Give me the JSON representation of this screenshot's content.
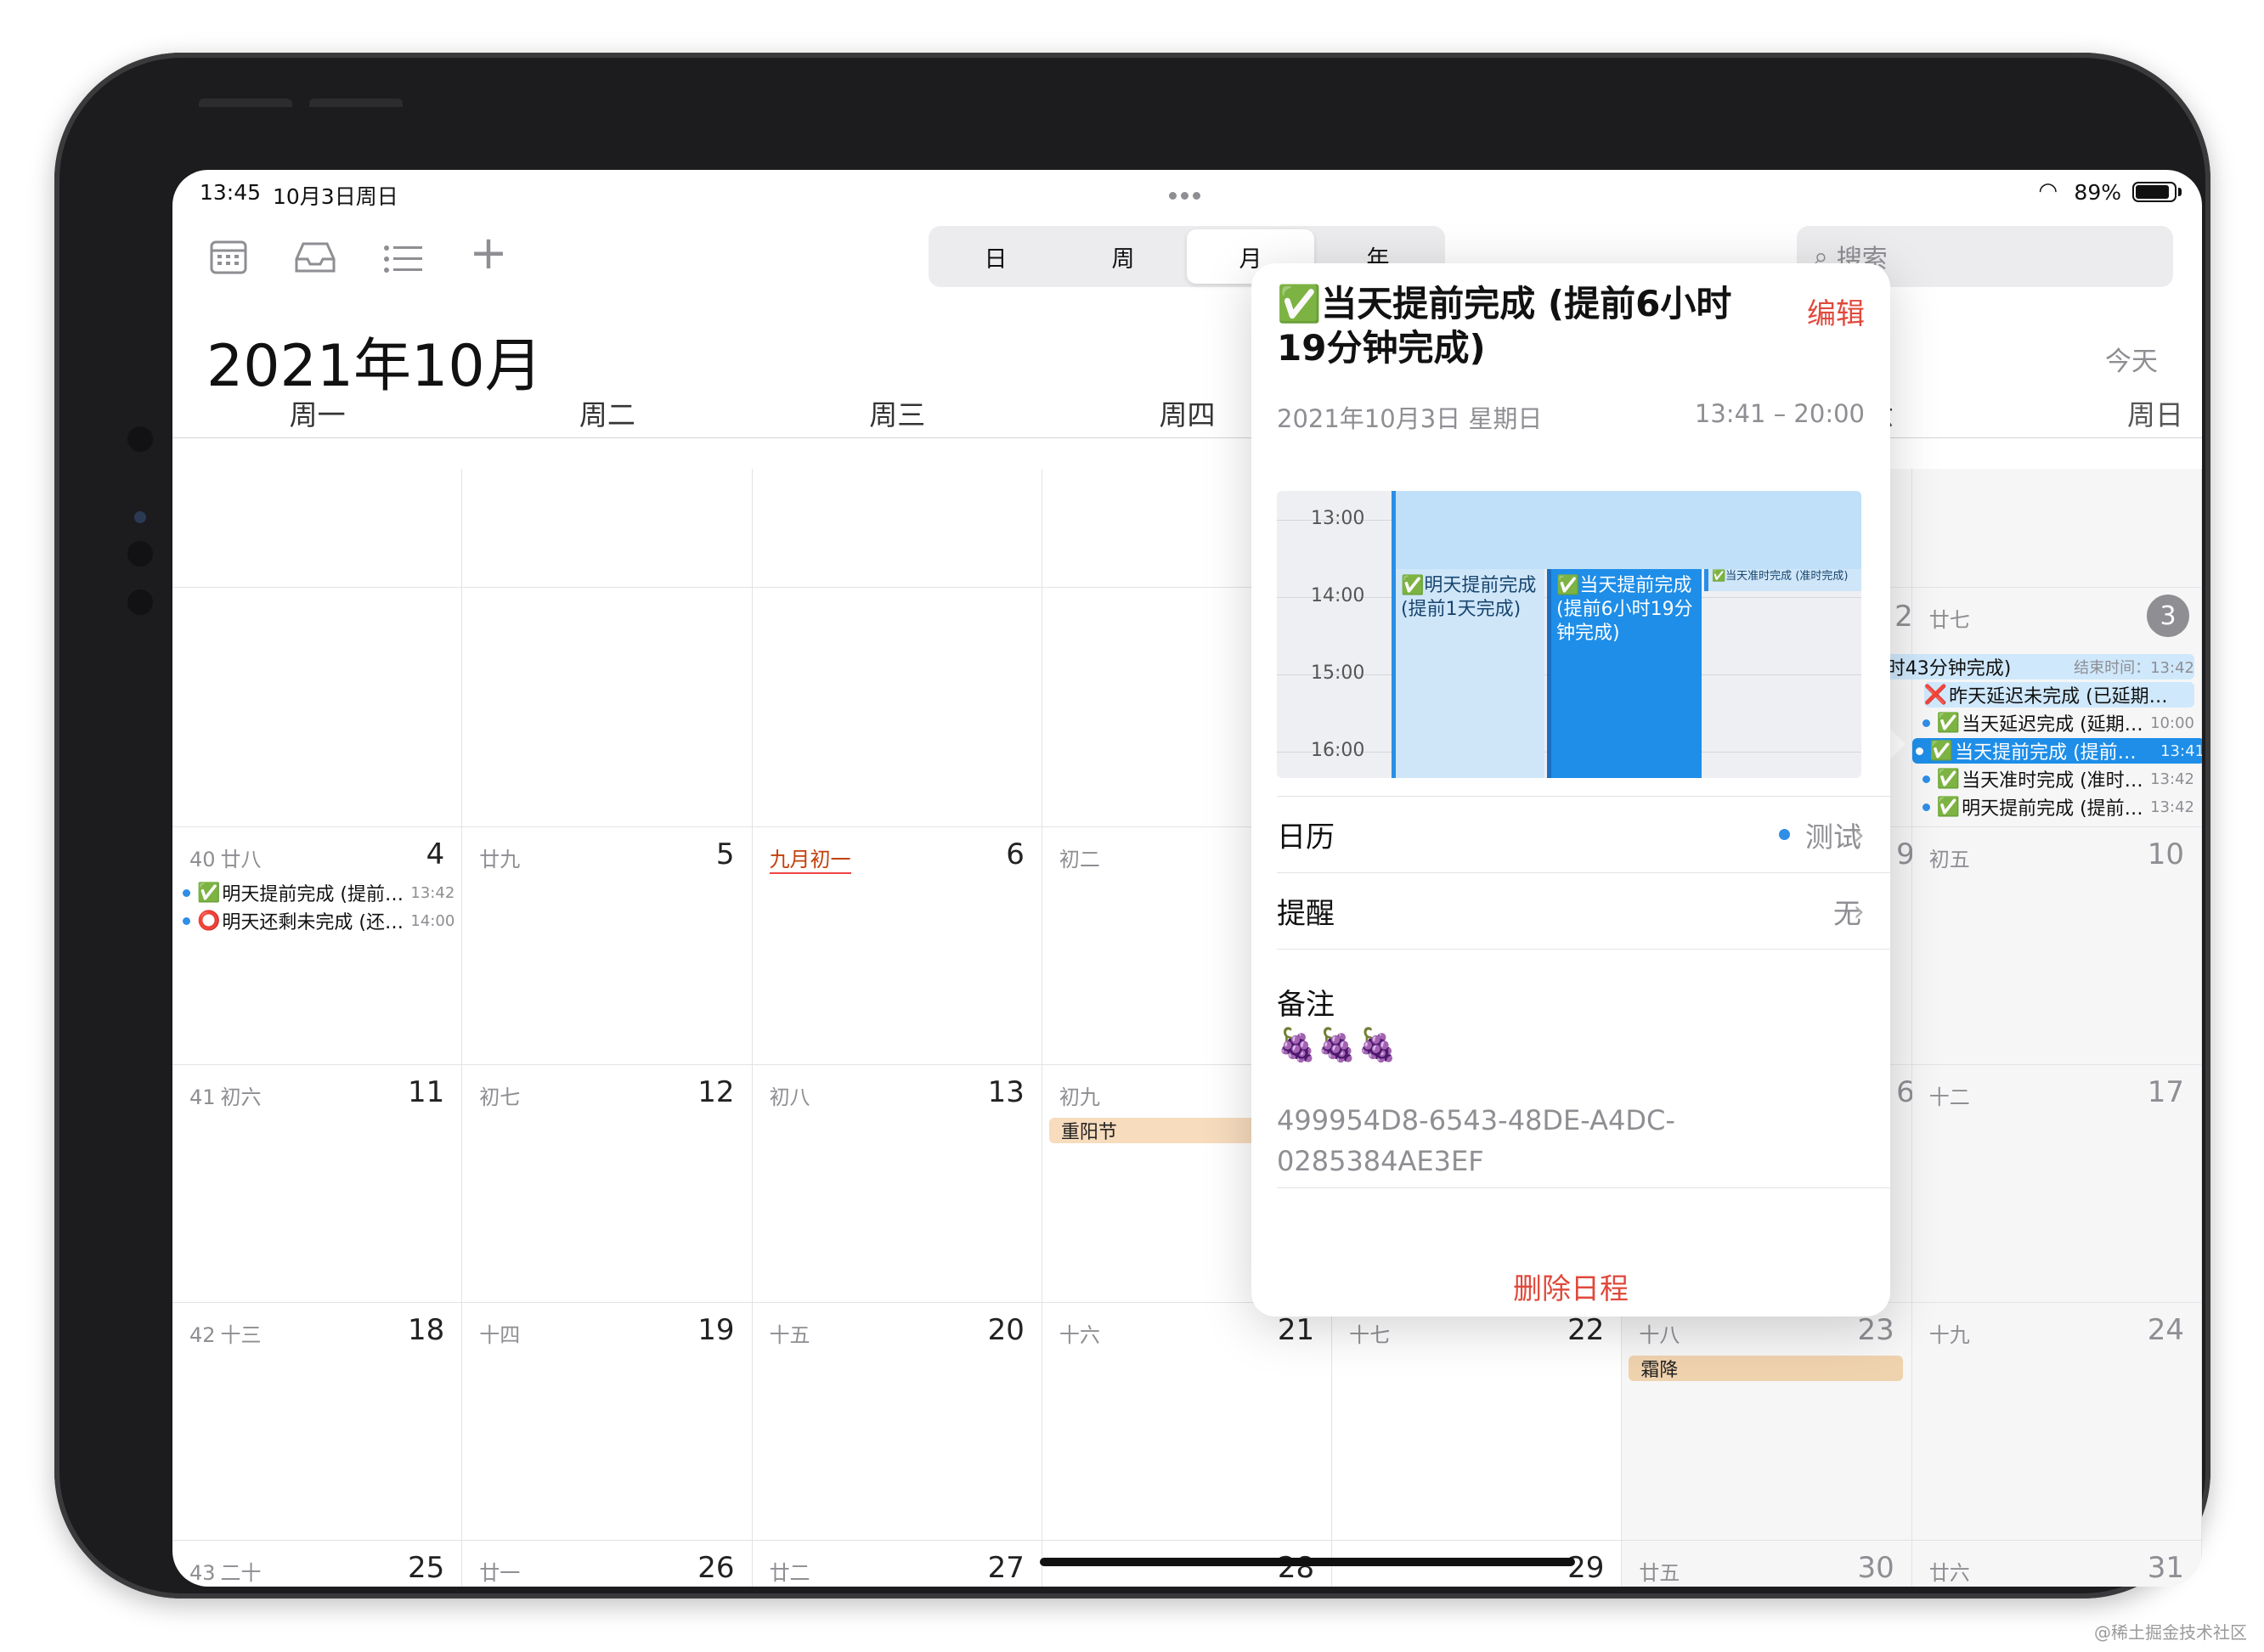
{
  "status_bar": {
    "time": "13:45",
    "date": "10月3日周日",
    "battery": "89%",
    "battery_level": 0.89
  },
  "toolbar": {
    "icons": [
      "calendar-icon",
      "inbox-icon",
      "list-icon",
      "add-icon"
    ],
    "segments": [
      "日",
      "周",
      "月",
      "年"
    ],
    "active_segment": "月",
    "search_placeholder": "搜索"
  },
  "header": {
    "month_title": "2021年10月",
    "today_button": "今天"
  },
  "weekdays": [
    "周一",
    "周二",
    "周三",
    "周四",
    "周五",
    "周六",
    "周日"
  ],
  "cells": {
    "r2_sun_lunar": "廿七",
    "r2_sun_day": "3",
    "r3_mon_week": "40",
    "r3_mon_lunar": "廿八",
    "r3_mon_day": "4",
    "r3_tue_lunar": "廿九",
    "r3_tue_day": "5",
    "r3_wed_lunar": "九月初一",
    "r3_wed_day": "6",
    "r3_thu_lunar": "初二",
    "r3_sun_lunar": "初五",
    "r3_sun_day": "10",
    "r4_mon_week": "41",
    "r4_mon_lunar": "初六",
    "r4_mon_day": "11",
    "r4_tue_lunar": "初七",
    "r4_tue_day": "12",
    "r4_wed_lunar": "初八",
    "r4_wed_day": "13",
    "r4_thu_lunar": "初九",
    "r4_sun_lunar": "十二",
    "r4_sun_day": "17",
    "r5_mon_week": "42",
    "r5_mon_lunar": "十三",
    "r5_mon_day": "18",
    "r5_tue_lunar": "十四",
    "r5_tue_day": "19",
    "r5_wed_lunar": "十五",
    "r5_wed_day": "20",
    "r5_thu_lunar": "十六",
    "r5_thu_day": "21",
    "r5_fri_lunar": "十七",
    "r5_fri_day": "22",
    "r5_sat_lunar": "十八",
    "r5_sat_day": "23",
    "r5_sun_lunar": "十九",
    "r5_sun_day": "24",
    "r6_mon_week": "43",
    "r6_mon_lunar": "二十",
    "r6_mon_day": "25",
    "r6_tue_lunar": "廿一",
    "r6_tue_day": "26",
    "r6_wed_lunar": "廿二",
    "r6_wed_day": "27",
    "r6_thu_day": "28",
    "r6_fri_day": "29",
    "r6_sat_lunar": "廿五",
    "r6_sat_day": "30",
    "r6_sun_lunar": "廿六",
    "r6_sun_day": "31"
  },
  "events": {
    "oct4_1": {
      "mark": "✅",
      "label": "明天提前完成 (提前…",
      "time": "13:42"
    },
    "oct4_2": {
      "mark": "⭕",
      "label": "明天还剩未完成 (还…",
      "time": "14:00"
    },
    "oct3_banner": {
      "label": "时43分钟完成)",
      "end": "结束时间：13:42"
    },
    "oct3_1": {
      "mark": "❌",
      "label": "昨天延迟未完成 (已延期…"
    },
    "oct3_2": {
      "mark": "✅",
      "label": "当天延迟完成 (延期…",
      "time": "10:00"
    },
    "oct3_3": {
      "mark": "✅",
      "label": "当天提前完成 (提前…",
      "time": "13:41"
    },
    "oct3_4": {
      "mark": "✅",
      "label": "当天准时完成 (准时…",
      "time": "13:42"
    },
    "oct3_5": {
      "mark": "✅",
      "label": "明天提前完成 (提前…",
      "time": "13:42"
    },
    "chongyang": "重阳节",
    "shuangjiang": "霜降"
  },
  "popover": {
    "title": "✅当天提前完成 (提前6小时19分钟完成)",
    "edit": "编辑",
    "date": "2021年10月3日 星期日",
    "time_range": "13:41 – 20:00",
    "mini_hours": [
      "13:00",
      "14:00",
      "15:00",
      "16:00"
    ],
    "mini_events": [
      "✅明天提前完成 (提前1天完成)",
      "✅当天提前完成 (提前6小时19分钟完成)",
      "✅当天准时完成 (准时完成)"
    ],
    "calendar_label": "日历",
    "calendar_value": "测试",
    "alert_label": "提醒",
    "alert_value": "无",
    "notes_label": "备注",
    "notes_body": "🍇🍇🍇",
    "uuid": "499954D8-6543-48DE-A4DC-0285384AE3EF",
    "delete": "删除日程"
  },
  "watermark": "@稀土掘金技术社区"
}
